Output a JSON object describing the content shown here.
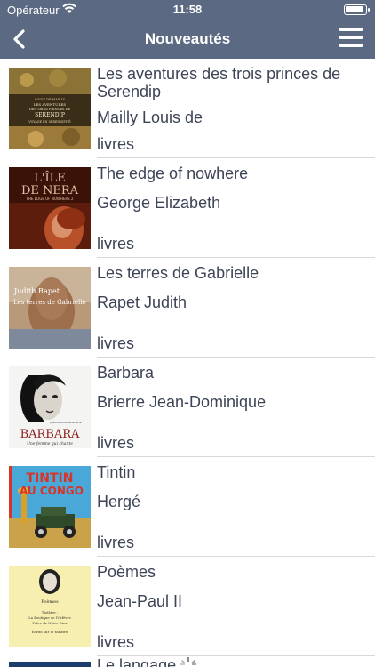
{
  "status": {
    "carrier": "Opérateur",
    "time": "11:58"
  },
  "nav": {
    "title": "Nouveautés",
    "back_icon": "chevron-left-icon",
    "menu_icon": "hamburger-menu-icon"
  },
  "colors": {
    "nav_bg": "#5b6a82",
    "text": "#3c4456",
    "separator": "#d6d9de"
  },
  "books": [
    {
      "title": "Les aventures des trois princes de Serendip",
      "author": "Mailly Louis de",
      "type": "livres",
      "cover_text": [
        "LOUIS DE MAILLY",
        "LES AVENTURES",
        "DES TROIS PRINCES DE",
        "SERENDIP",
        "VOYAGE EN SÉRENDIPITÉ"
      ]
    },
    {
      "title": "The edge of nowhere",
      "author": "George Elizabeth",
      "type": "livres",
      "cover_text": [
        "L'ÎLE",
        "DE NERA",
        "THE EDGE OF NOWHERE 2"
      ]
    },
    {
      "title": "Les terres de Gabrielle",
      "author": "Rapet Judith",
      "type": "livres",
      "cover_text": [
        "Judith Rapet",
        "Les terres de Gabrielle"
      ]
    },
    {
      "title": "Barbara",
      "author": "Brierre Jean-Dominique",
      "type": "livres",
      "cover_text": [
        "Jean-Dominique Brierre",
        "BARBARA",
        "Une femme qui chante"
      ]
    },
    {
      "title": "Tintin",
      "author": "Hergé",
      "type": "livres",
      "cover_text": [
        "TINTIN",
        "AU CONGO"
      ]
    },
    {
      "title": "Poèmes",
      "author": "Jean-Paul II",
      "type": "livres",
      "cover_text": [
        "Poèmes",
        "Théâtre :",
        "La Boutique de l'Orfèvre",
        "Frère de Notre Dieu",
        "Écrits sur le théâtre"
      ]
    }
  ],
  "partial_row": {
    "title": "Le langage"
  }
}
